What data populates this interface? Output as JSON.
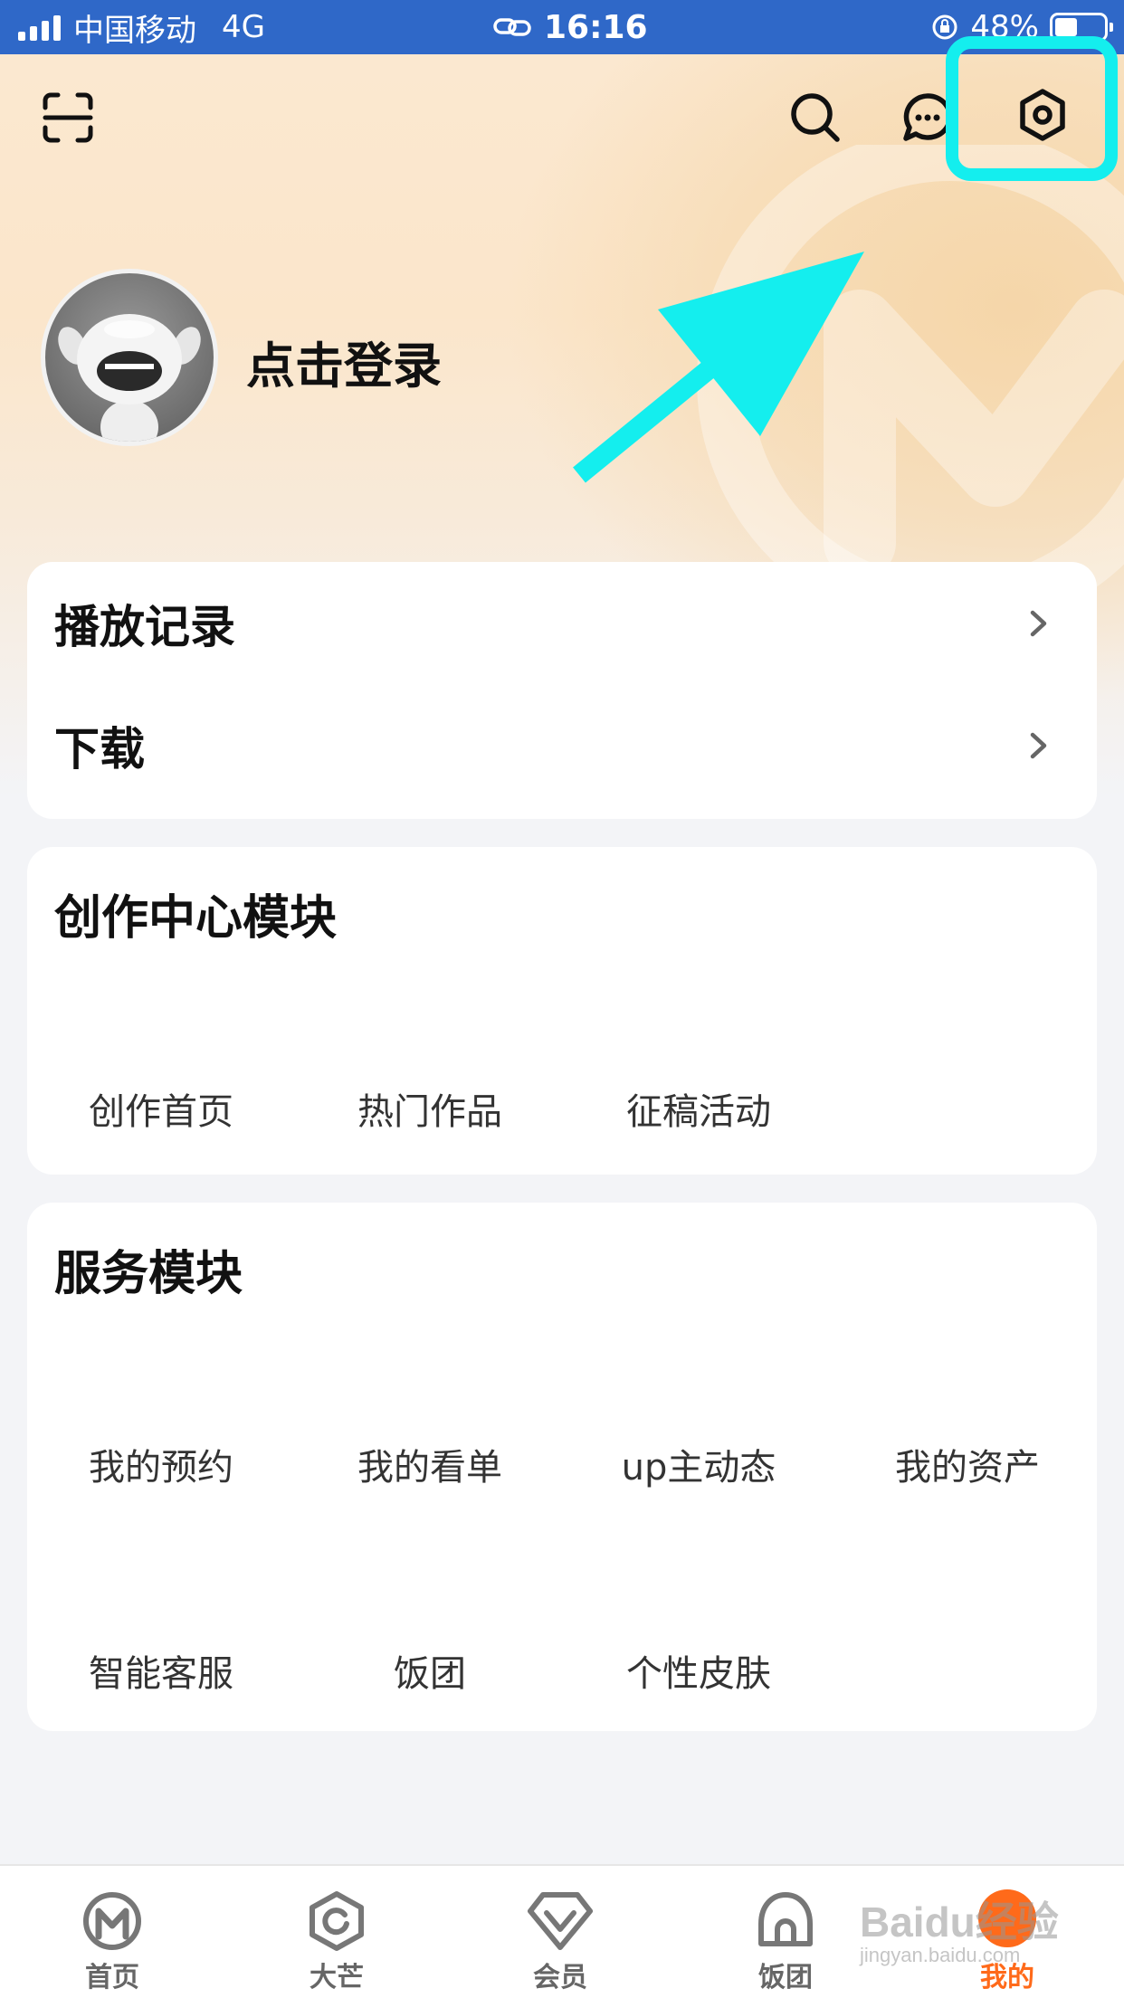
{
  "status_bar": {
    "carrier": "中国移动",
    "network": "4G",
    "time": "16:16",
    "battery": "48%"
  },
  "profile": {
    "login_text": "点击登录"
  },
  "records": {
    "items": [
      {
        "label": "播放记录"
      },
      {
        "label": "下载"
      }
    ]
  },
  "creation": {
    "title": "创作中心模块",
    "items": [
      "创作首页",
      "热门作品",
      "征稿活动"
    ]
  },
  "service": {
    "title": "服务模块",
    "row1": [
      "我的预约",
      "我的看单",
      "up主动态",
      "我的资产"
    ],
    "row2": [
      "智能客服",
      "饭团",
      "个性皮肤"
    ]
  },
  "bottom_nav": {
    "items": [
      {
        "label": "首页",
        "icon": "mango-logo-icon",
        "active": false
      },
      {
        "label": "大芒",
        "icon": "damang-icon",
        "active": false
      },
      {
        "label": "会员",
        "icon": "vip-diamond-icon",
        "active": false
      },
      {
        "label": "饭团",
        "icon": "fantuan-icon",
        "active": false
      },
      {
        "label": "我的",
        "icon": "mine-icon",
        "active": true
      }
    ]
  },
  "watermark": {
    "text": "Baidu经验",
    "subtext": "jingyan.baidu.com"
  },
  "colors": {
    "status_bar": "#2f68c8",
    "highlight": "#14eeee",
    "accent": "#ff6a1a"
  }
}
